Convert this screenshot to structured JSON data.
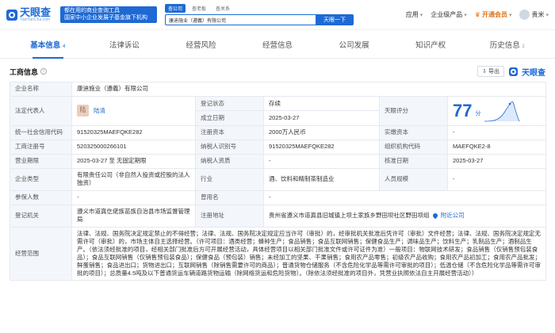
{
  "header": {
    "logo_name": "天眼查",
    "logo_url": "TianYanCha.com",
    "slogan_line1": "都在用的商业查询工具",
    "slogan_line2": "国家中小企业发展子基金旗下机构",
    "search_tabs": [
      "查公司",
      "查老板",
      "查关系"
    ],
    "search_value": "康迪施业（遵義）有限公司",
    "search_button": "天眼一下",
    "nav": {
      "app": "应用",
      "enterprise": "企业级产品",
      "vip": "开通会员",
      "user": "贵米"
    }
  },
  "tabs": [
    {
      "label": "基本信息",
      "count": "4"
    },
    {
      "label": "法律诉讼",
      "count": ""
    },
    {
      "label": "经营风险",
      "count": ""
    },
    {
      "label": "经营信息",
      "count": ""
    },
    {
      "label": "公司发展",
      "count": ""
    },
    {
      "label": "知识产权",
      "count": ""
    },
    {
      "label": "历史信息",
      "count": "2"
    }
  ],
  "section": {
    "title": "工商信息",
    "export": "导出",
    "brand": "天眼查"
  },
  "info": {
    "company_name_label": "企业名称",
    "company_name": "康迪施业（遵義）有限公司",
    "legal_rep_label": "法定代表人",
    "legal_rep_avatar": "陆",
    "legal_rep": "陆清",
    "reg_status_label": "登记状态",
    "reg_status": "存续",
    "est_date_label": "成立日期",
    "est_date": "2025-03-27",
    "score_label": "天眼评分",
    "score": "77",
    "score_unit": "分",
    "credit_code_label": "统一社会信用代码",
    "credit_code": "91520325MAEFQKE282",
    "reg_capital_label": "注册资本",
    "reg_capital": "2000万人民币",
    "paid_capital_label": "实缴资本",
    "paid_capital": "-",
    "reg_no_label": "工商注册号",
    "reg_no": "520325000266101",
    "tax_id_label": "纳税人识别号",
    "tax_id": "91520325MAEFQKE282",
    "org_code_label": "组织机构代码",
    "org_code": "MAEFQKE2-8",
    "biz_term_label": "营业期限",
    "biz_term": "2025-03-27 至 无固定期限",
    "taxpayer_qual_label": "纳税人资质",
    "taxpayer_qual": "-",
    "approval_date_label": "核准日期",
    "approval_date": "2025-03-27",
    "company_type_label": "企业类型",
    "company_type": "有限责任公司（非自然人投资或控股的法人独资）",
    "industry_label": "行业",
    "industry": "酒、饮料和精制茶制造业",
    "staff_size_label": "人员规模",
    "staff_size": "-",
    "insured_label": "参保人数",
    "insured": "-",
    "former_name_label": "曾用名",
    "former_name": "-",
    "reg_authority_label": "登记机关",
    "reg_authority": "遵义市道真仡佬族苗族自治县市场监督管理局",
    "address_label": "注册地址",
    "address": "贵州省遵义市道真县旧城镇上坝土家族乡野田坝社区野田坝组",
    "nearby": "附近公司",
    "scope_label": "经营范围",
    "scope": "法律、法规、国务院决定规定禁止的不得经营；法律、法规、国务院决定规定应当许可（审批）的，经审批机关批准后凭许可（审批）文件经营；法律、法规、国务院决定规定无需许可（审批）的，市场主体自主选择经营。（许可项目：酒类经营；蜂种生产；食品销售；食品互联网销售；保健食品生产；调味品生产；饮料生产；乳制品生产；酒制品生产。（依法须经批准的项目，经相关部门批准后方可开展经营活动，具体经营项目以相关部门批准文件或许可证件为准）一般项目：物联网技术研发；食品销售（仅销售预包装食品）；食品互联网销售（仅销售预包装食品）；保健食品（预包装）销售；未经加工的坚果、干果销售；食用农产品零售；初级农产品收购；食用农产品初加工；食用农产品批发；鲜蛋销售；食品进出口；货物进出口；互联网销售（除销售需要许可的商品）；普通货物仓储服务（不含危险化学品等需许可审批的项目）；低温仓储（不含危险化学品等需许可审批的项目）；总质量4.5吨及以下普通货运车辆道路货物运输（除网络货运和危险货物）。（除依法须经批准的项目外，凭营业执照依法自主开展经营活动））"
  }
}
